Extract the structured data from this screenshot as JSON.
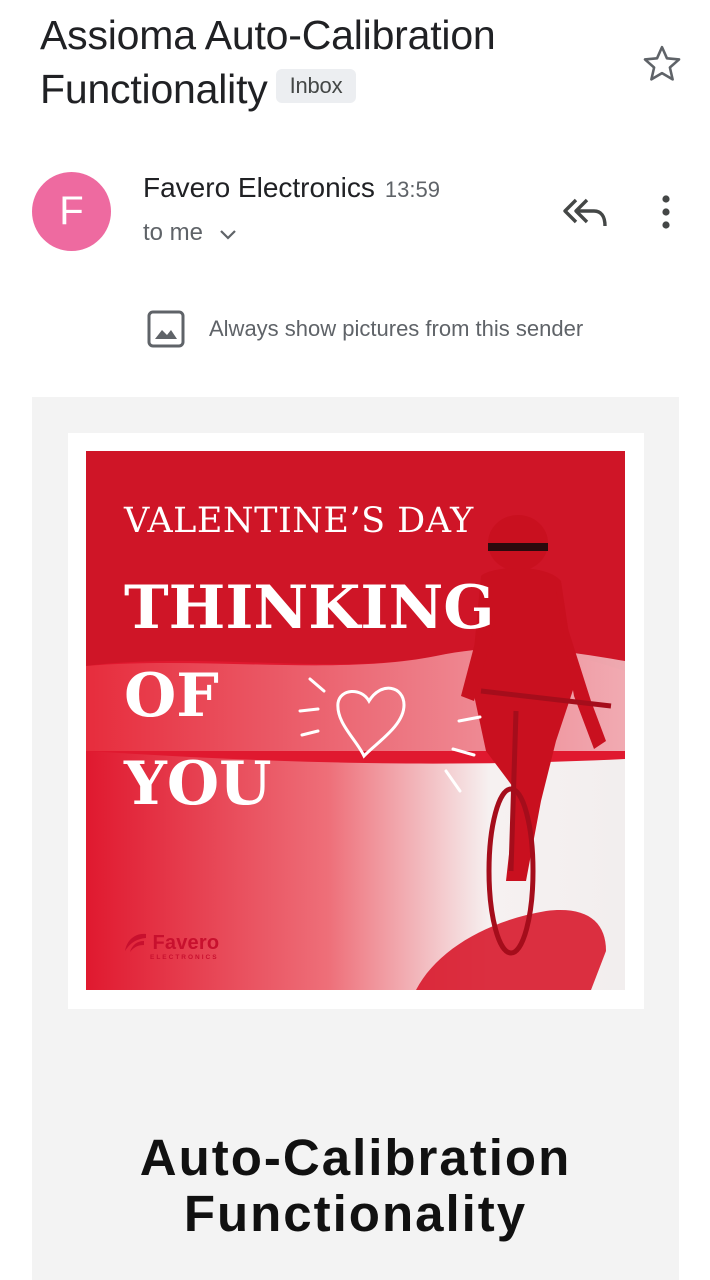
{
  "email": {
    "subject_line1": "Assioma Auto-Calibration",
    "subject_line2": "Functionality",
    "label": "Inbox",
    "sender_initial": "F",
    "sender_name": "Favero Electronics",
    "time": "13:59",
    "recipient": "to me",
    "always_show_pictures": "Always show pictures from this sender"
  },
  "icons": {
    "star": "star-outline-icon",
    "reply_all": "reply-all-icon",
    "more": "more-vert-icon",
    "image": "image-icon",
    "chevron": "chevron-down-icon"
  },
  "body": {
    "hero": {
      "line1": "VALENTINE’S DAY",
      "line2": "THINKING",
      "line3": "OF",
      "line4": "YOU",
      "logo_name": "Favero",
      "logo_sub": "ELECTRONICS"
    },
    "heading_line1": "Auto-Calibration",
    "heading_line2": "Functionality"
  },
  "colors": {
    "avatar": "#ee6aa0",
    "hero_red": "#e0192f",
    "body_bg": "#f3f3f3"
  }
}
